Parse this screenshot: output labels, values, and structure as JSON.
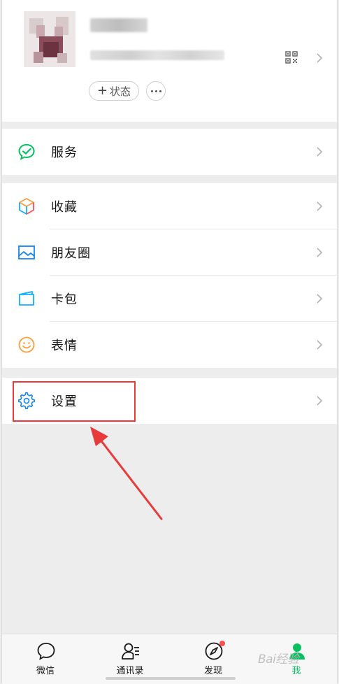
{
  "profile": {
    "status_label": "状态",
    "status_plus": "+"
  },
  "menu": {
    "services": "服务",
    "favorites": "收藏",
    "moments": "朋友圈",
    "cards": "卡包",
    "stickers": "表情",
    "settings": "设置"
  },
  "tabbar": {
    "chats": "微信",
    "contacts": "通讯录",
    "discover": "发现",
    "me": "我"
  },
  "watermark": "Bai经验",
  "colors": {
    "brand_green": "#07c160",
    "highlight_red": "#e83a3a",
    "badge_red": "#fa5151",
    "background": "#ededed"
  }
}
